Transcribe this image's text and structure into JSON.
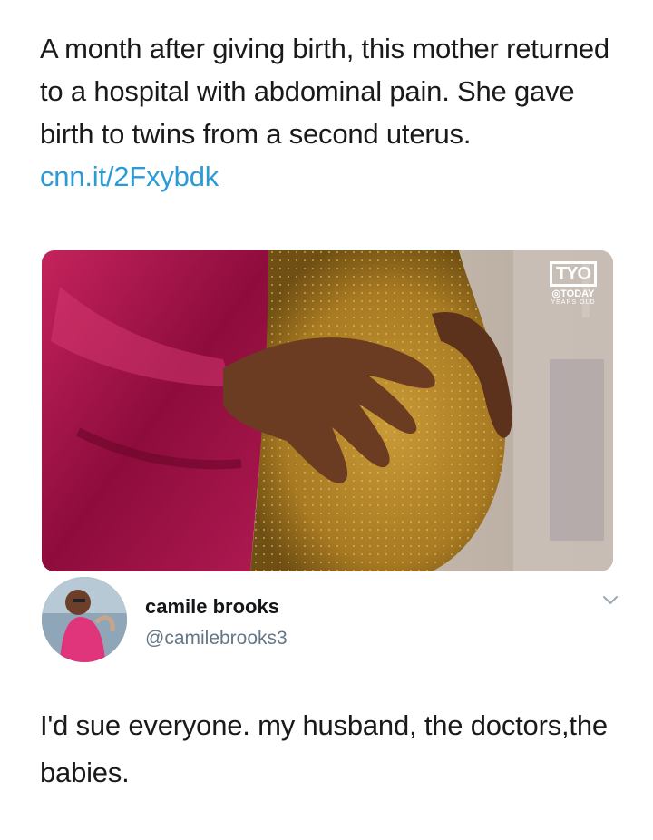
{
  "headline": {
    "text": "A month after giving birth, this mother returned to a hospital with abdominal pain. She gave birth to twins from a second uterus. ",
    "link": "cnn.it/2Fxybdk"
  },
  "media": {
    "badge_main": "TYO",
    "badge_sub": "◎TODAY",
    "badge_small": "YEARS OLD"
  },
  "reply": {
    "display_name": "camile brooks",
    "handle": "@camilebrooks3",
    "text": "I'd sue everyone. my husband, the doctors,the babies."
  },
  "colors": {
    "link": "#2b9bd6",
    "handle": "#657786",
    "jacket": "#a8124b",
    "dress": "#b8892a"
  }
}
